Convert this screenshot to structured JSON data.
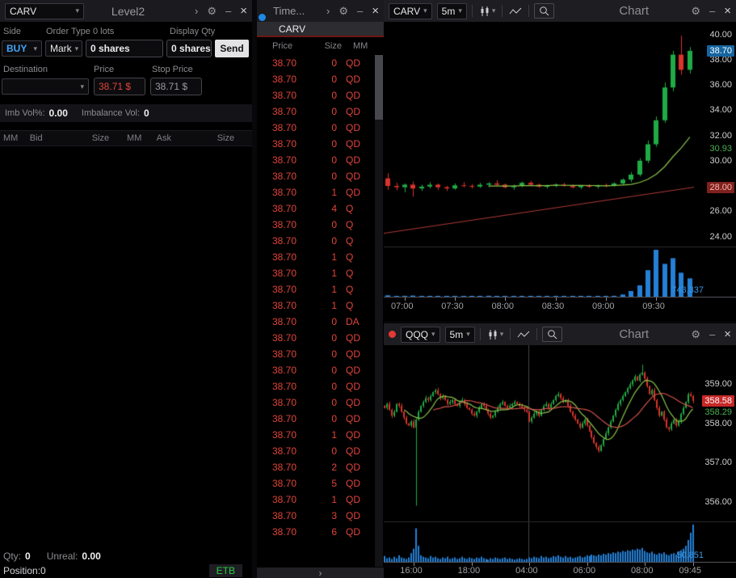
{
  "colors": {
    "buy-blue": "#42a5f5",
    "tape-red": "#e0453a",
    "etb-green": "#2ecc40",
    "link-blue": "#1e88e5",
    "link-red": "#e53935",
    "volume-blue": "#3b93e0",
    "price-red": "#e0453a"
  },
  "level2": {
    "symbol": "CARV",
    "title": "Level2",
    "order_labels": {
      "side": "Side",
      "type": "Order Type",
      "lots": "0 lots",
      "display": "Display Qty"
    },
    "side_value": "BUY",
    "type_value": "Mark",
    "shares_value": "0 shares",
    "display_value": "0 shares",
    "send_label": "Send",
    "row2_labels": {
      "destination": "Destination",
      "price": "Price",
      "stop": "Stop Price"
    },
    "price_value": "38.71 $",
    "stop_value": "38.71 $",
    "imbalance": {
      "pct_label": "Imb Vol%:",
      "pct": "0.00",
      "vol_label": "Imbalance Vol:",
      "vol": "0"
    },
    "book_columns": [
      "MM",
      "Bid",
      "Size",
      "MM",
      "Ask",
      "Size"
    ],
    "footer": {
      "qty_label": "Qty:",
      "qty": "0",
      "unreal_label": "Unreal:",
      "unreal": "0.00",
      "position": "Position:0",
      "etb": "ETB"
    }
  },
  "time_sales": {
    "title": "Time...",
    "tab": "CARV",
    "columns": [
      "Price",
      "Size",
      "MM"
    ],
    "chevron": "›",
    "rows": [
      [
        "38.70",
        "0",
        "QD"
      ],
      [
        "38.70",
        "0",
        "QD"
      ],
      [
        "38.70",
        "0",
        "QD"
      ],
      [
        "38.70",
        "0",
        "QD"
      ],
      [
        "38.70",
        "0",
        "QD"
      ],
      [
        "38.70",
        "0",
        "QD"
      ],
      [
        "38.70",
        "0",
        "QD"
      ],
      [
        "38.70",
        "0",
        "QD"
      ],
      [
        "38.70",
        "1",
        "QD"
      ],
      [
        "38.70",
        "4",
        "Q"
      ],
      [
        "38.70",
        "0",
        "Q"
      ],
      [
        "38.70",
        "0",
        "Q"
      ],
      [
        "38.70",
        "1",
        "Q"
      ],
      [
        "38.70",
        "1",
        "Q"
      ],
      [
        "38.70",
        "1",
        "Q"
      ],
      [
        "38.70",
        "1",
        "Q"
      ],
      [
        "38.70",
        "0",
        "DA"
      ],
      [
        "38.70",
        "0",
        "QD"
      ],
      [
        "38.70",
        "0",
        "QD"
      ],
      [
        "38.70",
        "0",
        "QD"
      ],
      [
        "38.70",
        "0",
        "QD"
      ],
      [
        "38.70",
        "0",
        "QD"
      ],
      [
        "38.70",
        "0",
        "QD"
      ],
      [
        "38.70",
        "1",
        "QD"
      ],
      [
        "38.70",
        "0",
        "QD"
      ],
      [
        "38.70",
        "2",
        "QD"
      ],
      [
        "38.70",
        "5",
        "QD"
      ],
      [
        "38.70",
        "1",
        "QD"
      ],
      [
        "38.70",
        "3",
        "QD"
      ],
      [
        "38.70",
        "6",
        "QD"
      ]
    ]
  },
  "chart_data": [
    {
      "type": "candlestick",
      "symbol": "CARV",
      "timeframe": "5m",
      "title": "Chart",
      "ylim": [
        23.2,
        41.0
      ],
      "yticks": [
        {
          "text": "40.00",
          "v": 40
        },
        {
          "text": "38.00",
          "v": 38
        },
        {
          "text": "36.00",
          "v": 36
        },
        {
          "text": "34.00",
          "v": 34
        },
        {
          "text": "32.00",
          "v": 32
        },
        {
          "text": "30.00",
          "v": 30
        },
        {
          "text": "28.00",
          "v": 28
        },
        {
          "text": "26.00",
          "v": 26
        },
        {
          "text": "24.00",
          "v": 24
        }
      ],
      "markers": [
        {
          "text": "38.70",
          "v": 38.7,
          "color": "#ffffff",
          "bg": "#1565a0"
        },
        {
          "text": "30.93",
          "v": 30.93,
          "color": "#4caf50",
          "bg": ""
        },
        {
          "text": "28.00",
          "v": 27.9,
          "color": "#ffb4ae",
          "bg": "#7e211d"
        }
      ],
      "xticks": [
        {
          "label": "07:00",
          "i": 2
        },
        {
          "label": "07:30",
          "i": 8
        },
        {
          "label": "08:00",
          "i": 14
        },
        {
          "label": "08:30",
          "i": 20
        },
        {
          "label": "09:00",
          "i": 26
        },
        {
          "label": "09:30",
          "i": 32
        }
      ],
      "bars": [
        [
          28.6,
          29.0,
          27.7,
          28.0
        ],
        [
          28.0,
          28.25,
          27.65,
          27.9
        ],
        [
          27.9,
          28.2,
          27.5,
          28.1
        ],
        [
          28.1,
          28.35,
          27.15,
          27.8
        ],
        [
          27.8,
          28.1,
          27.6,
          27.95
        ],
        [
          27.95,
          28.3,
          27.8,
          28.1
        ],
        [
          28.1,
          28.2,
          27.7,
          27.9
        ],
        [
          27.9,
          28.0,
          27.6,
          27.8
        ],
        [
          27.8,
          28.2,
          27.7,
          28.05
        ],
        [
          28.05,
          28.3,
          27.9,
          28.0
        ],
        [
          28.0,
          28.15,
          27.8,
          27.95
        ],
        [
          27.95,
          28.25,
          27.85,
          28.1
        ],
        [
          28.1,
          28.3,
          27.9,
          28.2
        ],
        [
          28.2,
          28.45,
          28.0,
          28.1
        ],
        [
          28.1,
          28.2,
          27.8,
          27.9
        ],
        [
          27.9,
          28.1,
          27.7,
          28.0
        ],
        [
          28.0,
          28.35,
          27.9,
          28.25
        ],
        [
          28.25,
          28.4,
          28.0,
          28.1
        ],
        [
          28.1,
          28.2,
          27.85,
          27.95
        ],
        [
          27.95,
          28.1,
          27.8,
          28.0
        ],
        [
          28.0,
          28.2,
          27.9,
          28.1
        ],
        [
          28.1,
          28.25,
          27.95,
          28.0
        ],
        [
          28.0,
          28.1,
          27.8,
          27.9
        ],
        [
          27.9,
          28.05,
          27.75,
          28.0
        ],
        [
          28.0,
          28.15,
          27.85,
          27.95
        ],
        [
          27.95,
          28.1,
          27.8,
          28.05
        ],
        [
          28.05,
          28.2,
          27.9,
          28.0
        ],
        [
          28.0,
          28.3,
          27.95,
          28.2
        ],
        [
          28.2,
          28.6,
          28.1,
          28.5
        ],
        [
          28.5,
          29.1,
          28.3,
          28.9
        ],
        [
          28.9,
          30.2,
          28.75,
          30.0
        ],
        [
          30.0,
          31.6,
          29.8,
          31.3
        ],
        [
          31.3,
          33.5,
          31.1,
          33.2
        ],
        [
          33.2,
          36.2,
          33.0,
          35.8
        ],
        [
          35.8,
          38.7,
          35.5,
          38.4
        ],
        [
          38.4,
          39.9,
          36.8,
          37.2
        ],
        [
          37.2,
          39.0,
          36.9,
          38.7
        ]
      ],
      "volumes": [
        22,
        9,
        14,
        18,
        7,
        11,
        9,
        6,
        12,
        8,
        7,
        10,
        15,
        9,
        8,
        11,
        13,
        9,
        7,
        8,
        10,
        9,
        7,
        6,
        8,
        9,
        7,
        14,
        35,
        90,
        180,
        420,
        743,
        520,
        610,
        380,
        290
      ],
      "volume_label": "743,337",
      "ma": [
        {
          "period": 13,
          "color": "#8bc34a"
        }
      ],
      "trendline": {
        "from": 24.25,
        "to": 27.9,
        "color": "#b03a36"
      },
      "session_breaks": [],
      "up_color": "#1fab45",
      "down_color": "#d9342b",
      "vol_color": "#2480d6"
    },
    {
      "type": "candlestick",
      "symbol": "QQQ",
      "timeframe": "5m",
      "title": "Chart",
      "link_color": "#e53935",
      "ylim": [
        355.5,
        360.0
      ],
      "yticks": [
        {
          "text": "359.00",
          "v": 359
        },
        {
          "text": "358.00",
          "v": 358
        },
        {
          "text": "357.00",
          "v": 357
        },
        {
          "text": "356.00",
          "v": 356
        }
      ],
      "markers": [
        {
          "text": "358.58",
          "v": 358.58,
          "color": "#ffffff",
          "bg": "#c62828"
        },
        {
          "text": "358.29",
          "v": 358.29,
          "color": "#4caf50",
          "bg": ""
        }
      ],
      "xticks": [
        {
          "label": "16:00",
          "i": 12
        },
        {
          "label": "18:00",
          "i": 36
        },
        {
          "label": "04:00",
          "i": 60
        },
        {
          "label": "06:00",
          "i": 84
        },
        {
          "label": "08:00",
          "i": 108
        },
        {
          "label": "09:45",
          "i": 128
        }
      ],
      "closes": [
        358.4,
        358.5,
        358.35,
        358.2,
        358.3,
        358.5,
        358.45,
        358.3,
        358.15,
        358.0,
        357.95,
        358.05,
        357.9,
        358.1,
        358.3,
        358.45,
        358.55,
        358.65,
        358.6,
        358.7,
        358.8,
        358.85,
        358.75,
        358.65,
        358.7,
        358.6,
        358.5,
        358.55,
        358.6,
        358.5,
        358.45,
        358.55,
        358.6,
        358.5,
        358.4,
        358.35,
        358.25,
        358.2,
        358.3,
        358.4,
        358.5,
        358.45,
        358.35,
        358.25,
        358.15,
        358.2,
        358.3,
        358.4,
        358.5,
        358.55,
        358.45,
        358.4,
        358.45,
        358.5,
        358.55,
        358.5,
        358.45,
        358.4,
        358.35,
        358.3,
        358.05,
        358.15,
        358.25,
        358.3,
        358.2,
        358.35,
        358.45,
        358.5,
        358.4,
        358.5,
        358.6,
        358.7,
        358.75,
        358.65,
        358.55,
        358.6,
        358.45,
        358.3,
        358.2,
        358.1,
        358.0,
        357.9,
        358.0,
        358.1,
        357.95,
        357.8,
        357.65,
        357.5,
        357.4,
        357.3,
        357.45,
        357.6,
        357.75,
        357.9,
        358.05,
        358.2,
        358.35,
        358.5,
        358.6,
        358.7,
        358.8,
        358.9,
        359.0,
        359.1,
        359.2,
        359.1,
        359.25,
        359.3,
        359.15,
        358.95,
        358.75,
        358.85,
        358.6,
        358.4,
        358.2,
        358.3,
        358.1,
        357.9,
        357.85,
        358.0,
        358.1,
        357.95,
        358.05,
        358.25,
        358.4,
        358.55,
        358.75,
        358.7,
        358.58
      ],
      "spikes": [
        {
          "i": 13,
          "l": 355.9
        },
        {
          "i": 107,
          "h": 359.5
        }
      ],
      "session_breaks": [
        60
      ],
      "volumes": [
        8,
        5,
        6,
        4,
        7,
        5,
        9,
        6,
        5,
        4,
        6,
        12,
        18,
        46,
        22,
        9,
        7,
        6,
        5,
        8,
        6,
        7,
        5,
        4,
        6,
        5,
        7,
        4,
        5,
        6,
        4,
        5,
        7,
        5,
        4,
        6,
        5,
        4,
        6,
        5,
        7,
        5,
        4,
        3,
        5,
        4,
        6,
        5,
        4,
        5,
        6,
        4,
        5,
        4,
        3,
        4,
        5,
        4,
        3,
        4,
        6,
        5,
        7,
        6,
        5,
        8,
        6,
        7,
        5,
        6,
        8,
        7,
        9,
        7,
        6,
        8,
        6,
        7,
        5,
        6,
        7,
        8,
        6,
        7,
        9,
        8,
        10,
        9,
        8,
        10,
        9,
        11,
        10,
        12,
        11,
        13,
        12,
        14,
        13,
        15,
        14,
        16,
        15,
        17,
        16,
        18,
        17,
        19,
        15,
        13,
        12,
        14,
        11,
        10,
        12,
        11,
        13,
        10,
        9,
        11,
        12,
        10,
        14,
        16,
        18,
        22,
        30,
        40,
        51
      ],
      "volume_label": "50,851",
      "ma": [
        {
          "period": 9,
          "color": "#8bc34a"
        },
        {
          "period": 21,
          "color": "#d4524a"
        }
      ],
      "up_color": "#1fab45",
      "down_color": "#d9342b",
      "vol_color": "#2480d6"
    }
  ]
}
